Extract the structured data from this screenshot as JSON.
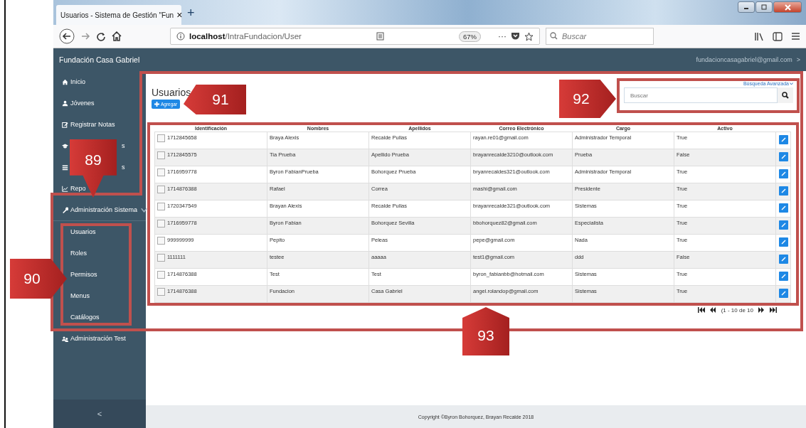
{
  "browser": {
    "tab_title": "Usuarios - Sistema de Gestión \"Fun",
    "tab_close": "×",
    "new_tab": "+",
    "url_host": "localhost",
    "url_path": "/IntraFundacion/User",
    "zoom": "67%",
    "more": "···",
    "search_placeholder": "Buscar"
  },
  "header": {
    "brand": "Fundación Casa Gabriel",
    "account": "fundacioncasagabriel@gmail.com",
    "account_caret": ">"
  },
  "sidebar": {
    "items": [
      {
        "label": "Inicio",
        "kind": "plain"
      },
      {
        "label": "Jóvenes",
        "kind": "plain"
      },
      {
        "label": "Registrar Notas",
        "kind": "plain"
      },
      {
        "label": "s",
        "kind": "obscured"
      },
      {
        "label": "s",
        "kind": "obscured"
      },
      {
        "label": "Repo",
        "kind": "plain"
      },
      {
        "label": "Administración Sistema",
        "kind": "group",
        "expanded": true,
        "children": [
          {
            "label": "Usuarios"
          },
          {
            "label": "Roles"
          },
          {
            "label": "Permisos"
          },
          {
            "label": "Menus"
          },
          {
            "label": "Catálogos"
          }
        ]
      },
      {
        "label": "Administración Test",
        "kind": "plain"
      }
    ],
    "collapse": "<"
  },
  "page": {
    "title": "Usuarios",
    "add_button": "Agregar",
    "advanced_search": "Búsqueda Avanzada",
    "search_placeholder": "Buscar"
  },
  "table": {
    "columns": [
      "Identificación",
      "Nombres",
      "Apellidos",
      "Correo Electrónico",
      "Cargo",
      "Activo"
    ],
    "rows": [
      {
        "checked": false,
        "cells": [
          "1712845658",
          "Braya Alexis",
          "Recalde Pullas",
          "rayan.re01@gmail.com",
          "Administrador Temporal",
          "True"
        ]
      },
      {
        "checked": false,
        "cells": [
          "1712845575",
          "Tia Prueba",
          "Apellido Prueba",
          "brayanrecalde3210@outlook.com",
          "Prueba",
          "False"
        ]
      },
      {
        "checked": false,
        "cells": [
          "1716959778",
          "Byron FabianPrueba",
          "Bohorquez Prueba",
          "bryanrecaldes321@outlook.com",
          "Administrador Temporal",
          "True"
        ]
      },
      {
        "checked": false,
        "cells": [
          "1714876388",
          "Rafael",
          "Correa",
          "mashi@gmail.com",
          "Presidente",
          "True"
        ]
      },
      {
        "checked": false,
        "cells": [
          "1720347549",
          "Brayan Alexis",
          "Recalde Pullas",
          "brayanrecalde321@outlook.com",
          "Sistemas",
          "True"
        ]
      },
      {
        "checked": false,
        "cells": [
          "1716959778",
          "Byron Fabian",
          "Bohorquez Sevilla",
          "bbohorquez82@gmail.com",
          "Especialista",
          "True"
        ]
      },
      {
        "checked": false,
        "cells": [
          "999999999",
          "Pepito",
          "Peleas",
          "pepe@gmail.com",
          "Nada",
          "True"
        ]
      },
      {
        "checked": false,
        "cells": [
          "1111111",
          "testee",
          "aaaaa",
          "test1@gmail.com",
          "ddd",
          "False"
        ]
      },
      {
        "checked": false,
        "cells": [
          "1714876388",
          "Test",
          "Test",
          "byron_fabianbb@hotmail.com",
          "Sistemas",
          "True"
        ]
      },
      {
        "checked": false,
        "cells": [
          "1714876388",
          "Fundacion",
          "Casa Gabriel",
          "angel.rolandop@gmail.com",
          "Sistemas",
          "True"
        ]
      }
    ]
  },
  "pager": {
    "text": "(1 - 10 de 10"
  },
  "footer": "Copyright ©Byron Bohorquez, Brayan Recalde 2018",
  "annotations": [
    "89",
    "90",
    "91",
    "92",
    "93"
  ]
}
